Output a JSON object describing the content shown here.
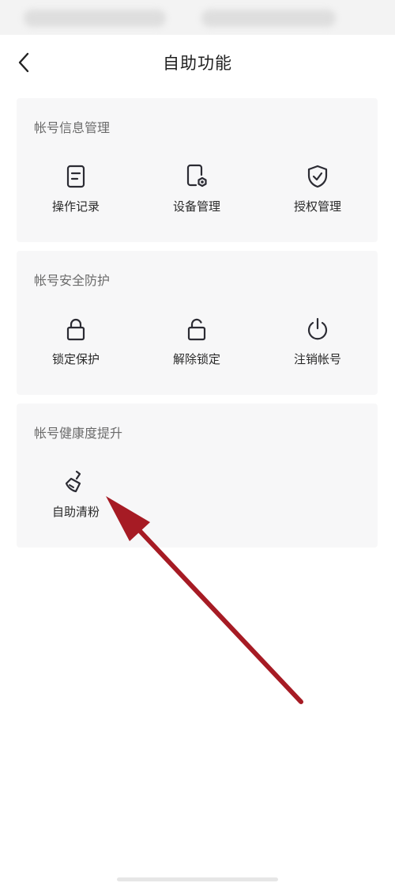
{
  "header": {
    "title": "自助功能"
  },
  "sections": [
    {
      "title": "帐号信息管理",
      "items": [
        {
          "label": "操作记录",
          "icon": "document-icon"
        },
        {
          "label": "设备管理",
          "icon": "device-settings-icon"
        },
        {
          "label": "授权管理",
          "icon": "shield-check-icon"
        }
      ]
    },
    {
      "title": "帐号安全防护",
      "items": [
        {
          "label": "锁定保护",
          "icon": "lock-icon"
        },
        {
          "label": "解除锁定",
          "icon": "unlock-icon"
        },
        {
          "label": "注销帐号",
          "icon": "power-icon"
        }
      ]
    },
    {
      "title": "帐号健康度提升",
      "items": [
        {
          "label": "自助清粉",
          "icon": "broom-icon"
        }
      ]
    }
  ],
  "colors": {
    "icon": "#2b2b33",
    "annotation_arrow": "#a61b24"
  }
}
